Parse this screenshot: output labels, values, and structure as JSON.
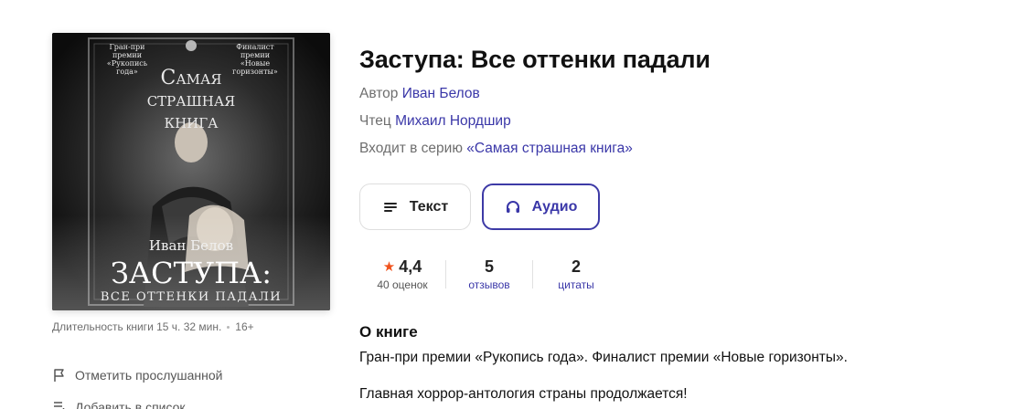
{
  "book": {
    "title": "Заступа: Все оттенки падали",
    "author_label": "Автор",
    "author": "Иван Белов",
    "narrator_label": "Чтец",
    "narrator": "Михаил Нордшир",
    "series_label": "Входит в серию",
    "series": "«Самая страшная книга»"
  },
  "cover": {
    "award_left": [
      "Гран-при",
      "премии",
      "«Рукопись",
      "года»"
    ],
    "award_right": [
      "Финалист",
      "премии",
      "«Новые",
      "горизонты»"
    ],
    "series_line1": "Самая",
    "series_line2": "страшная",
    "series_line3": "книга",
    "author": "Иван Белов",
    "title_main": "ЗАСТУПА:",
    "title_sub": "ВСЕ ОТТЕНКИ ПАДАЛИ"
  },
  "duration": {
    "text": "Длительность книги 15 ч. 32 мин.",
    "age": "16+"
  },
  "side_actions": {
    "mark_listened": "Отметить прослушанной",
    "add_to_list": "Добавить в список"
  },
  "formats": {
    "text_label": "Текст",
    "audio_label": "Аудио",
    "selected": "audio"
  },
  "stats": {
    "rating": "4,4",
    "rating_count": "40 оценок",
    "reviews": "5",
    "reviews_label": "отзывов",
    "quotes": "2",
    "quotes_label": "цитаты"
  },
  "about": {
    "heading": "О книге",
    "paragraph1": "Гран-при премии «Рукопись года». Финалист премии «Новые горизонты».",
    "paragraph2": "Главная хоррор-антология страны продолжается!"
  },
  "colors": {
    "accent": "#3a37a8",
    "star": "#f0521c",
    "muted_text": "#6e6e6e"
  },
  "icons": {
    "text_format": "lines-icon",
    "audio_format": "headphones-icon",
    "mark_listened": "flag-icon",
    "add_to_list": "list-add-icon",
    "rating": "star-icon"
  }
}
